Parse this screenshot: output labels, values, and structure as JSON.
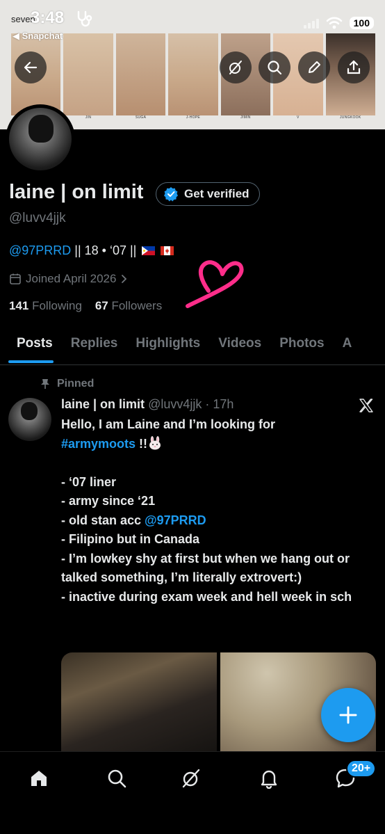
{
  "status_bar": {
    "time": "3:48",
    "carrier_overlay": "seven",
    "back_app": "◀ Snapchat",
    "battery": "100"
  },
  "banner": {
    "labels": [
      "",
      "JIN",
      "SUGA",
      "J-HOPE",
      "JIMIN",
      "V",
      "JUNGKOOK"
    ],
    "buttons": [
      "back-arrow-icon",
      "grok-icon",
      "search-icon",
      "edit-icon",
      "share-icon"
    ]
  },
  "profile": {
    "name": "laine | on limit",
    "verify_label": "Get verified",
    "handle": "@luvv4jjk",
    "bio_link": "@97PRRD",
    "bio_rest": " || 18 • ‘07 ||",
    "joined": "Joined April 2026",
    "following_count": "141",
    "following_label": " Following",
    "followers_count": "67",
    "followers_label": " Followers"
  },
  "tabs": [
    "Posts",
    "Replies",
    "Highlights",
    "Videos",
    "Photos",
    "A"
  ],
  "post": {
    "pinned_label": "Pinned",
    "author_name": "laine | on limit",
    "author_meta": " @luvv4jjk · 17h",
    "line1": "Hello, I am Laine and I’m looking for",
    "hashtag": "#armymoots",
    "hashtag_tail": " !!",
    "line_a": "- ‘07 liner",
    "line_b": "- army since ‘21",
    "line_c_pre": "- old stan acc ",
    "line_c_link": "@97PRRD",
    "line_d": "- Filipino but in Canada",
    "line_e": "- I’m lowkey shy at first but when we hang out or talked something, I’m literally extrovert:)",
    "line_f": "- inactive during exam week and hell week in sch"
  },
  "bottom_nav": {
    "items": [
      "home-icon",
      "search-icon",
      "grok-icon",
      "notifications-icon",
      "messages-icon"
    ],
    "messages_badge": "20+"
  },
  "colors": {
    "accent": "#1d9bf0",
    "muted": "#71767b",
    "text": "#e7e9ea",
    "heart_doodle": "#ff2d8a"
  }
}
